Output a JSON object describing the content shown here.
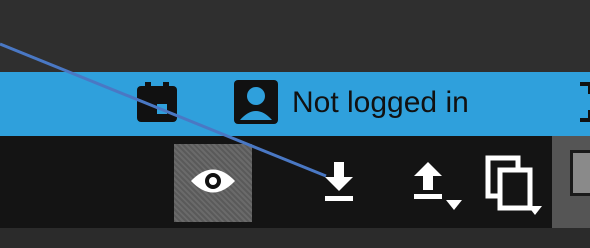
{
  "status_bar": {
    "login_status": "Not logged in",
    "background": "#2fa0dc"
  },
  "toolbar": {
    "buttons": [
      {
        "name": "eye",
        "icon": "eye-icon"
      },
      {
        "name": "download",
        "icon": "download-icon"
      },
      {
        "name": "upload",
        "icon": "upload-icon"
      },
      {
        "name": "duplicate",
        "icon": "copy-icon"
      }
    ]
  },
  "annotation": {
    "color": "#4a78c4"
  }
}
